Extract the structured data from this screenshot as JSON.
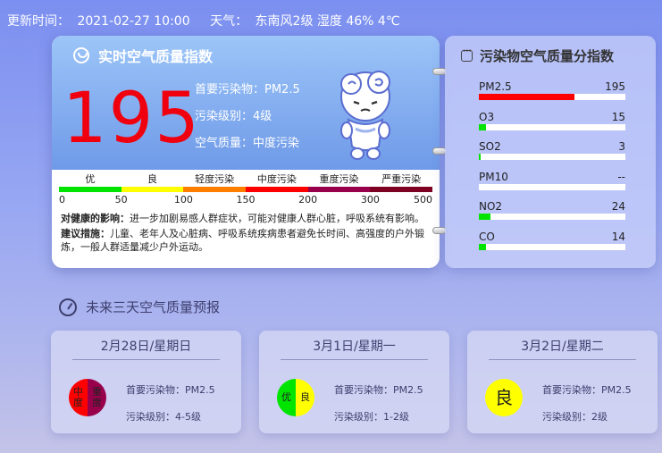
{
  "topbar": {
    "update_label": "更新时间：",
    "update_time": "2021-02-27 10:00",
    "weather_label": "天气：",
    "weather": "东南风2级 湿度 46% 4℃"
  },
  "realtime": {
    "title": "实时空气质量指数",
    "aqi": "195",
    "primary": "首要污染物：PM2.5",
    "level": "污染级别：4级",
    "quality": "空气质量：中度污染",
    "scale_labels": [
      "优",
      "良",
      "轻度污染",
      "中度污染",
      "重度污染",
      "严重污染"
    ],
    "scale_colors": [
      "#00e400",
      "#ffff00",
      "#ff7e00",
      "#ff0000",
      "#99004c",
      "#7e0023"
    ],
    "scale_ticks": [
      "0",
      "50",
      "100",
      "150",
      "200",
      "300",
      "500"
    ],
    "health_label": "对健康的影响：",
    "health_text": "进一步加剧易感人群症状，可能对健康人群心脏，呼吸系统有影响。",
    "advice_label": "建议措施：",
    "advice_text": "儿童、老年人及心脏病、呼吸系统疾病患者避免长时间、高强度的户外锻炼，一般人群适量减少户外运动。"
  },
  "pollutants": {
    "title": "污染物空气质量分指数",
    "items": [
      {
        "name": "PM2.5",
        "value": "195",
        "fraction": 0.65,
        "color": "#ff0000"
      },
      {
        "name": "O3",
        "value": "15",
        "fraction": 0.05,
        "color": "#00e400"
      },
      {
        "name": "SO2",
        "value": "3",
        "fraction": 0.01,
        "color": "#00e400"
      },
      {
        "name": "PM10",
        "value": "--",
        "fraction": 0,
        "color": "#00e400"
      },
      {
        "name": "NO2",
        "value": "24",
        "fraction": 0.08,
        "color": "#00e400"
      },
      {
        "name": "CO",
        "value": "14",
        "fraction": 0.05,
        "color": "#00e400"
      }
    ]
  },
  "forecast": {
    "title": "未来三天空气质量预报",
    "days": [
      {
        "day": "2月28日/星期日",
        "badges": [
          {
            "text": "中度",
            "color": "#ff0000"
          },
          {
            "text": "重度",
            "color": "#99004c"
          }
        ],
        "primary": "首要污染物：PM2.5",
        "level": "污染级别：4-5级"
      },
      {
        "day": "3月1日/星期一",
        "badges": [
          {
            "text": "优",
            "color": "#00e400"
          },
          {
            "text": "良",
            "color": "#ffff00"
          }
        ],
        "primary": "首要污染物：PM2.5",
        "level": "污染级别：1-2级"
      },
      {
        "day": "3月2日/星期二",
        "badges": [
          {
            "text": "良",
            "color": "#ffff00"
          }
        ],
        "primary": "首要污染物：PM2.5",
        "level": "污染级别：2级"
      }
    ]
  }
}
